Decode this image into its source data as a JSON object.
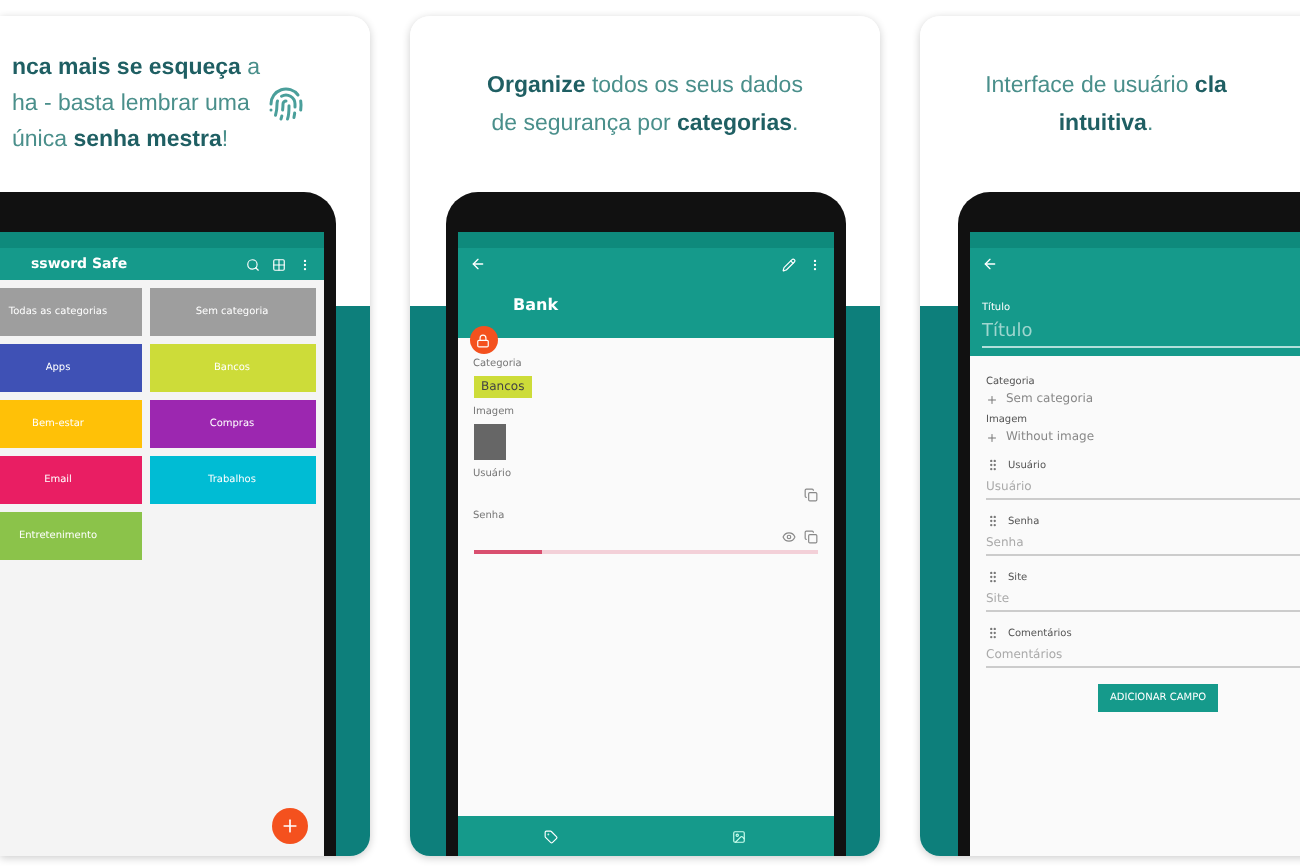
{
  "cards": [
    {
      "kind": "categories",
      "headline": [
        "**nca mais se esqueça** a",
        "ha - basta lembrar uma",
        "única **senha mestra**!"
      ],
      "app_title": "ssword Safe",
      "tiles": [
        {
          "name": "Todas as categorias",
          "color": "#9e9e9e"
        },
        {
          "name": "Sem categoria",
          "color": "#9e9e9e"
        },
        {
          "name": "Apps",
          "color": "#3f51b5"
        },
        {
          "name": "Bancos",
          "color": "#cddc39"
        },
        {
          "name": "Bem-estar",
          "color": "#ffc107"
        },
        {
          "name": "Compras",
          "color": "#9c27b0"
        },
        {
          "name": "Email",
          "color": "#e91e63"
        },
        {
          "name": "Trabalhos",
          "color": "#00bcd4"
        },
        {
          "name": "Entretenimento",
          "color": "#8bc34a"
        }
      ]
    },
    {
      "kind": "detail",
      "headline": [
        "**Organize** todos os seus dados",
        "de segurança por **categorias**."
      ],
      "entry_title": "Bank",
      "fields": [
        {
          "kind": "chip",
          "label": "Categoria",
          "value": "Bancos"
        },
        {
          "kind": "image",
          "label": "Imagem"
        },
        {
          "kind": "text",
          "label": "Usuário",
          "copy": true,
          "reveal": false
        },
        {
          "kind": "password",
          "label": "Senha",
          "copy": true,
          "reveal": true,
          "level": 0.2
        }
      ]
    },
    {
      "kind": "editor",
      "headline": [
        "Interface de usuário **cla**",
        "**intuitiva**."
      ],
      "title_label": "Título",
      "title_placeholder": "Título",
      "pickers": [
        {
          "label": "Categoria",
          "value": "Sem categoria"
        },
        {
          "label": "Imagem",
          "value": "Without image"
        }
      ],
      "fields": [
        {
          "label": "Usuário",
          "placeholder": "Usuário"
        },
        {
          "label": "Senha",
          "placeholder": "Senha"
        },
        {
          "label": "Site",
          "placeholder": "Site"
        },
        {
          "label": "Comentários",
          "placeholder": "Comentários"
        }
      ],
      "button": "ADICIONAR CAMPO"
    }
  ]
}
